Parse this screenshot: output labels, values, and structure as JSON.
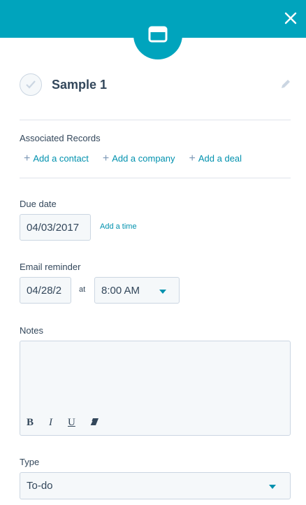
{
  "header": {
    "close_icon": "close-icon",
    "badge_icon": "task-icon",
    "accent": "#00a4bd"
  },
  "task": {
    "title": "Sample 1"
  },
  "associated": {
    "label": "Associated Records",
    "links": [
      "Add a contact",
      "Add a company",
      "Add a deal"
    ]
  },
  "due_date": {
    "label": "Due date",
    "value": "04/03/2017",
    "add_time": "Add a time"
  },
  "reminder": {
    "label": "Email reminder",
    "date_value": "04/28/2",
    "at": "at",
    "time_value": "8:00 AM"
  },
  "notes": {
    "label": "Notes",
    "toolbar": [
      "B",
      "I",
      "U"
    ]
  },
  "type": {
    "label": "Type",
    "value": "To-do"
  }
}
